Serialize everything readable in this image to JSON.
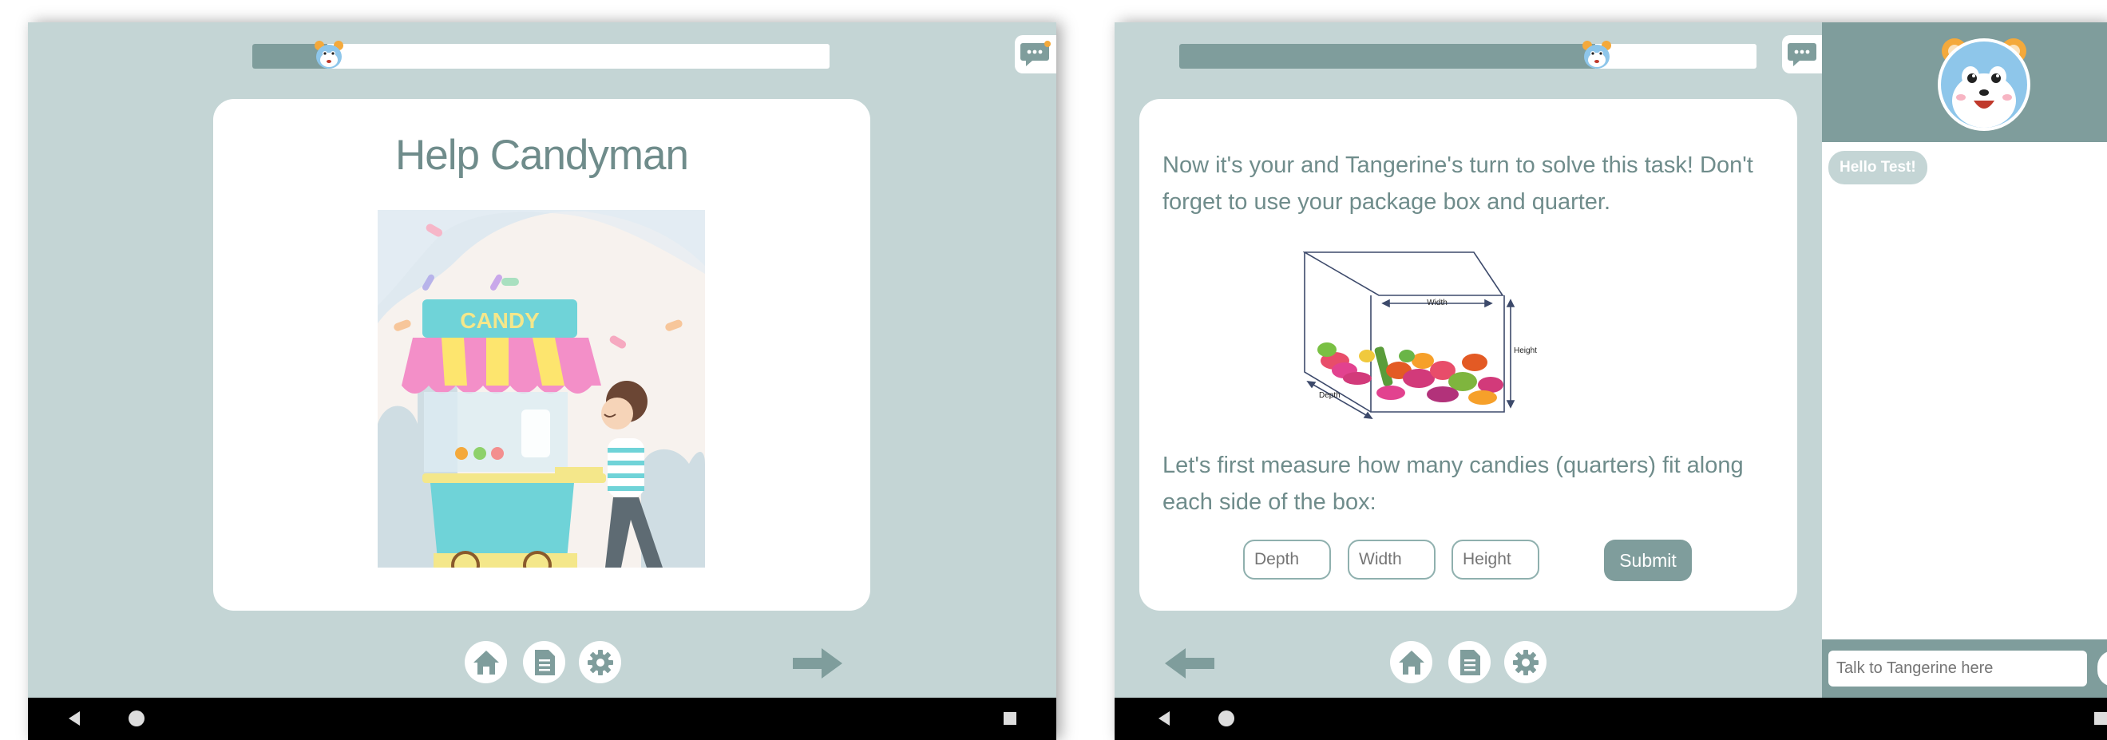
{
  "screen1": {
    "progress": 0.13,
    "title": "Help Candyman",
    "illustration_sign": "CANDY"
  },
  "screen2": {
    "progress": 0.72,
    "instruction": "Now it's your and Tangerine's turn to solve this task! Don't forget to use your package box and quarter.",
    "box_labels": {
      "width": "Width",
      "height": "Height",
      "depth": "Depth"
    },
    "question": "Let's first measure how many candies (quarters) fit along each side of the box:",
    "inputs": [
      {
        "placeholder": "Depth",
        "value": ""
      },
      {
        "placeholder": "Width",
        "value": ""
      },
      {
        "placeholder": "Height",
        "value": ""
      }
    ],
    "submit_label": "Submit"
  },
  "chat": {
    "messages": [
      "Hello Test!"
    ],
    "input_placeholder": "Talk to Tangerine here"
  },
  "icons": {
    "home": "home-icon",
    "document": "document-icon",
    "settings": "gear-icon",
    "next": "arrow-right-icon",
    "previous": "arrow-left-icon",
    "chat": "chat-bubble-icon",
    "android_back": "triangle-back-icon",
    "android_home": "circle-home-icon",
    "android_recents": "square-recents-icon"
  },
  "colors": {
    "background": "#c4d5d5",
    "accent": "#7f9d9c",
    "text": "#6f8c8b",
    "card": "#ffffff"
  }
}
